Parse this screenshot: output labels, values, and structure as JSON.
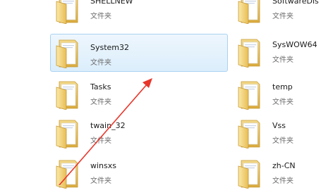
{
  "folders": [
    {
      "name": "SHELLNEW",
      "type": "文件夹"
    },
    {
      "name": "SoftwareDis",
      "type": "文件夹"
    },
    {
      "name": "System32",
      "type": "文件夹",
      "selected": true
    },
    {
      "name": "SysWOW64",
      "type": "文件夹"
    },
    {
      "name": "Tasks",
      "type": "文件夹"
    },
    {
      "name": "temp",
      "type": "文件夹"
    },
    {
      "name": "twain_32",
      "type": "文件夹"
    },
    {
      "name": "Vss",
      "type": "文件夹"
    },
    {
      "name": "winsxs",
      "type": "文件夹"
    },
    {
      "name": "zh-CN",
      "type": "文件夹"
    }
  ],
  "annotation": {
    "arrow_color": "#e8362b"
  },
  "icon": "folder-icon"
}
